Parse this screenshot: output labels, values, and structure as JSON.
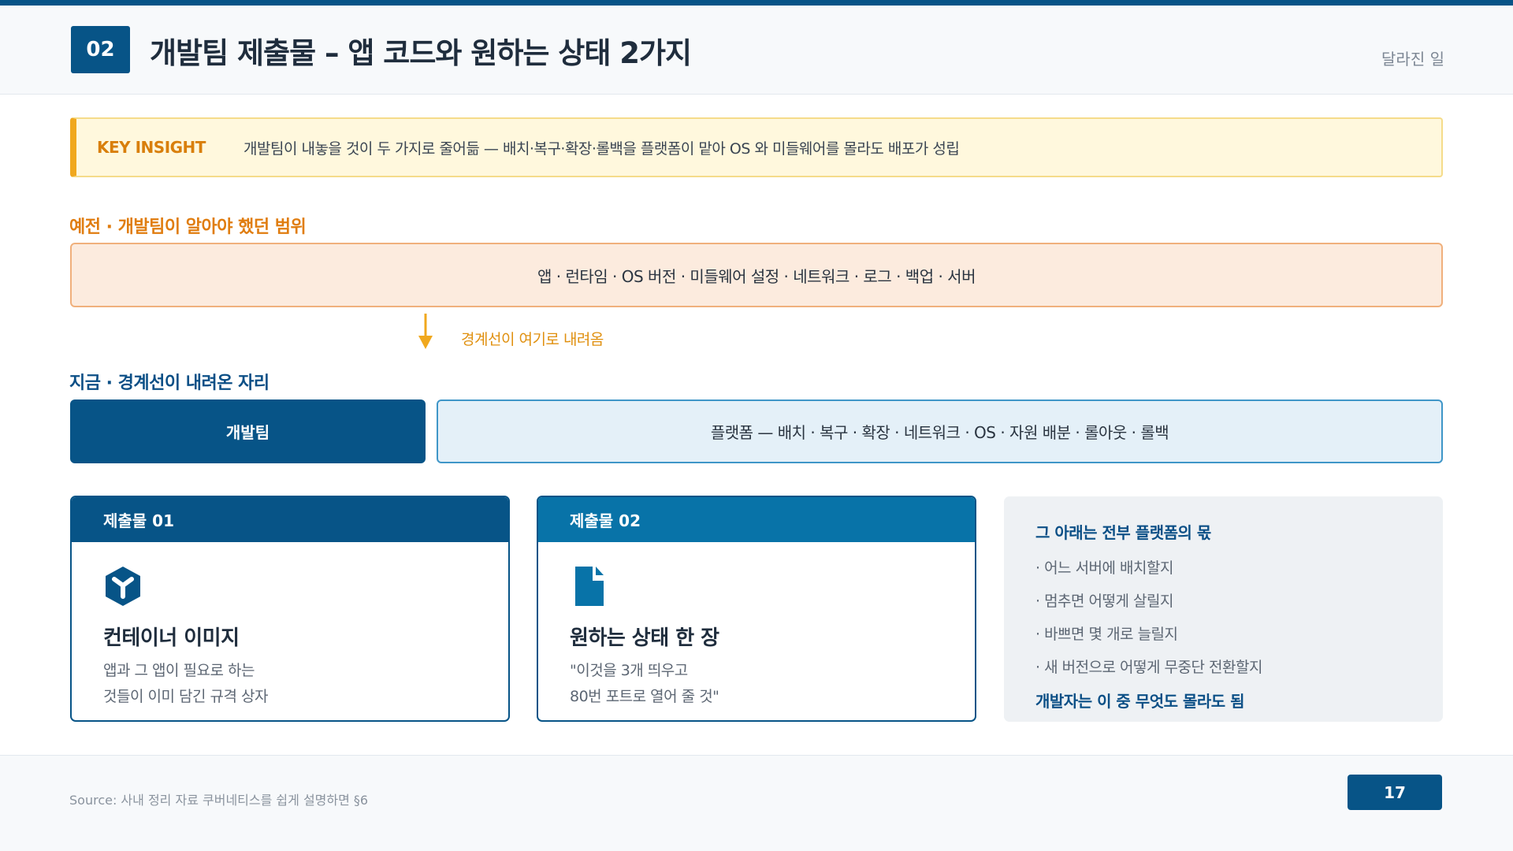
{
  "header": {
    "badge": "02",
    "title": "개발팀 제출물 – 앱 코드와 원하는 상태 2가지",
    "section_tag": "달라진 일"
  },
  "insight": {
    "label": "KEY INSIGHT",
    "text": "개발팀이 내놓을 것이 두 가지로 줄어듦 — 배치·복구·확장·롤백을 플랫폼이 맡아 OS 와 미들웨어를 몰라도 배포가 성립"
  },
  "before": {
    "label": "예전 · 개발팀이 알아야 했던 범위",
    "scope": "앱 · 런타임 · OS 버전 · 미들웨어 설정 · 네트워크 · 로그 · 백업 · 서버",
    "arrow_label": "경계선이 여기로 내려옴"
  },
  "now": {
    "label": "지금 · 경계선이 내려온 자리",
    "dev": "개발팀",
    "platform": "플랫폼 — 배치 · 복구 · 확장 · 네트워크 · OS · 자원 배분 · 롤아웃 · 롤백"
  },
  "cards": [
    {
      "head": "제출물 01",
      "icon": "container-cube-icon",
      "title": "컨테이너 이미지",
      "lines": [
        "앱과 그 앱이 필요로 하는",
        "것들이 이미 담긴 규격 상자"
      ]
    },
    {
      "head": "제출물 02",
      "icon": "document-icon",
      "title": "원하는 상태 한 장",
      "lines": [
        "\"이것을 3개 띄우고",
        "80번 포트로 열어 줄 것\""
      ]
    }
  ],
  "platform_bundle": {
    "head": "그 아래는 전부 플랫폼의 몫",
    "items": [
      "· 어느 서버에 배치할지",
      "· 멈추면 어떻게 살릴지",
      "· 바쁘면 몇 개로 늘릴지",
      "· 새 버전으로 어떻게 무중단 전환할지"
    ],
    "footer": "개발자는 이 중 무엇도 몰라도 됨"
  },
  "footer": {
    "source": "Source: 사내 정리 자료 쿠버네티스를 쉽게 설명하면 §6",
    "page": "17"
  },
  "colors": {
    "primary": "#075487",
    "secondary": "#0873a8",
    "accent_orange": "#e07d10",
    "insight_bg": "#fff8dd",
    "before_bg": "#fcebde",
    "platform_bg": "#e4f0f8"
  }
}
